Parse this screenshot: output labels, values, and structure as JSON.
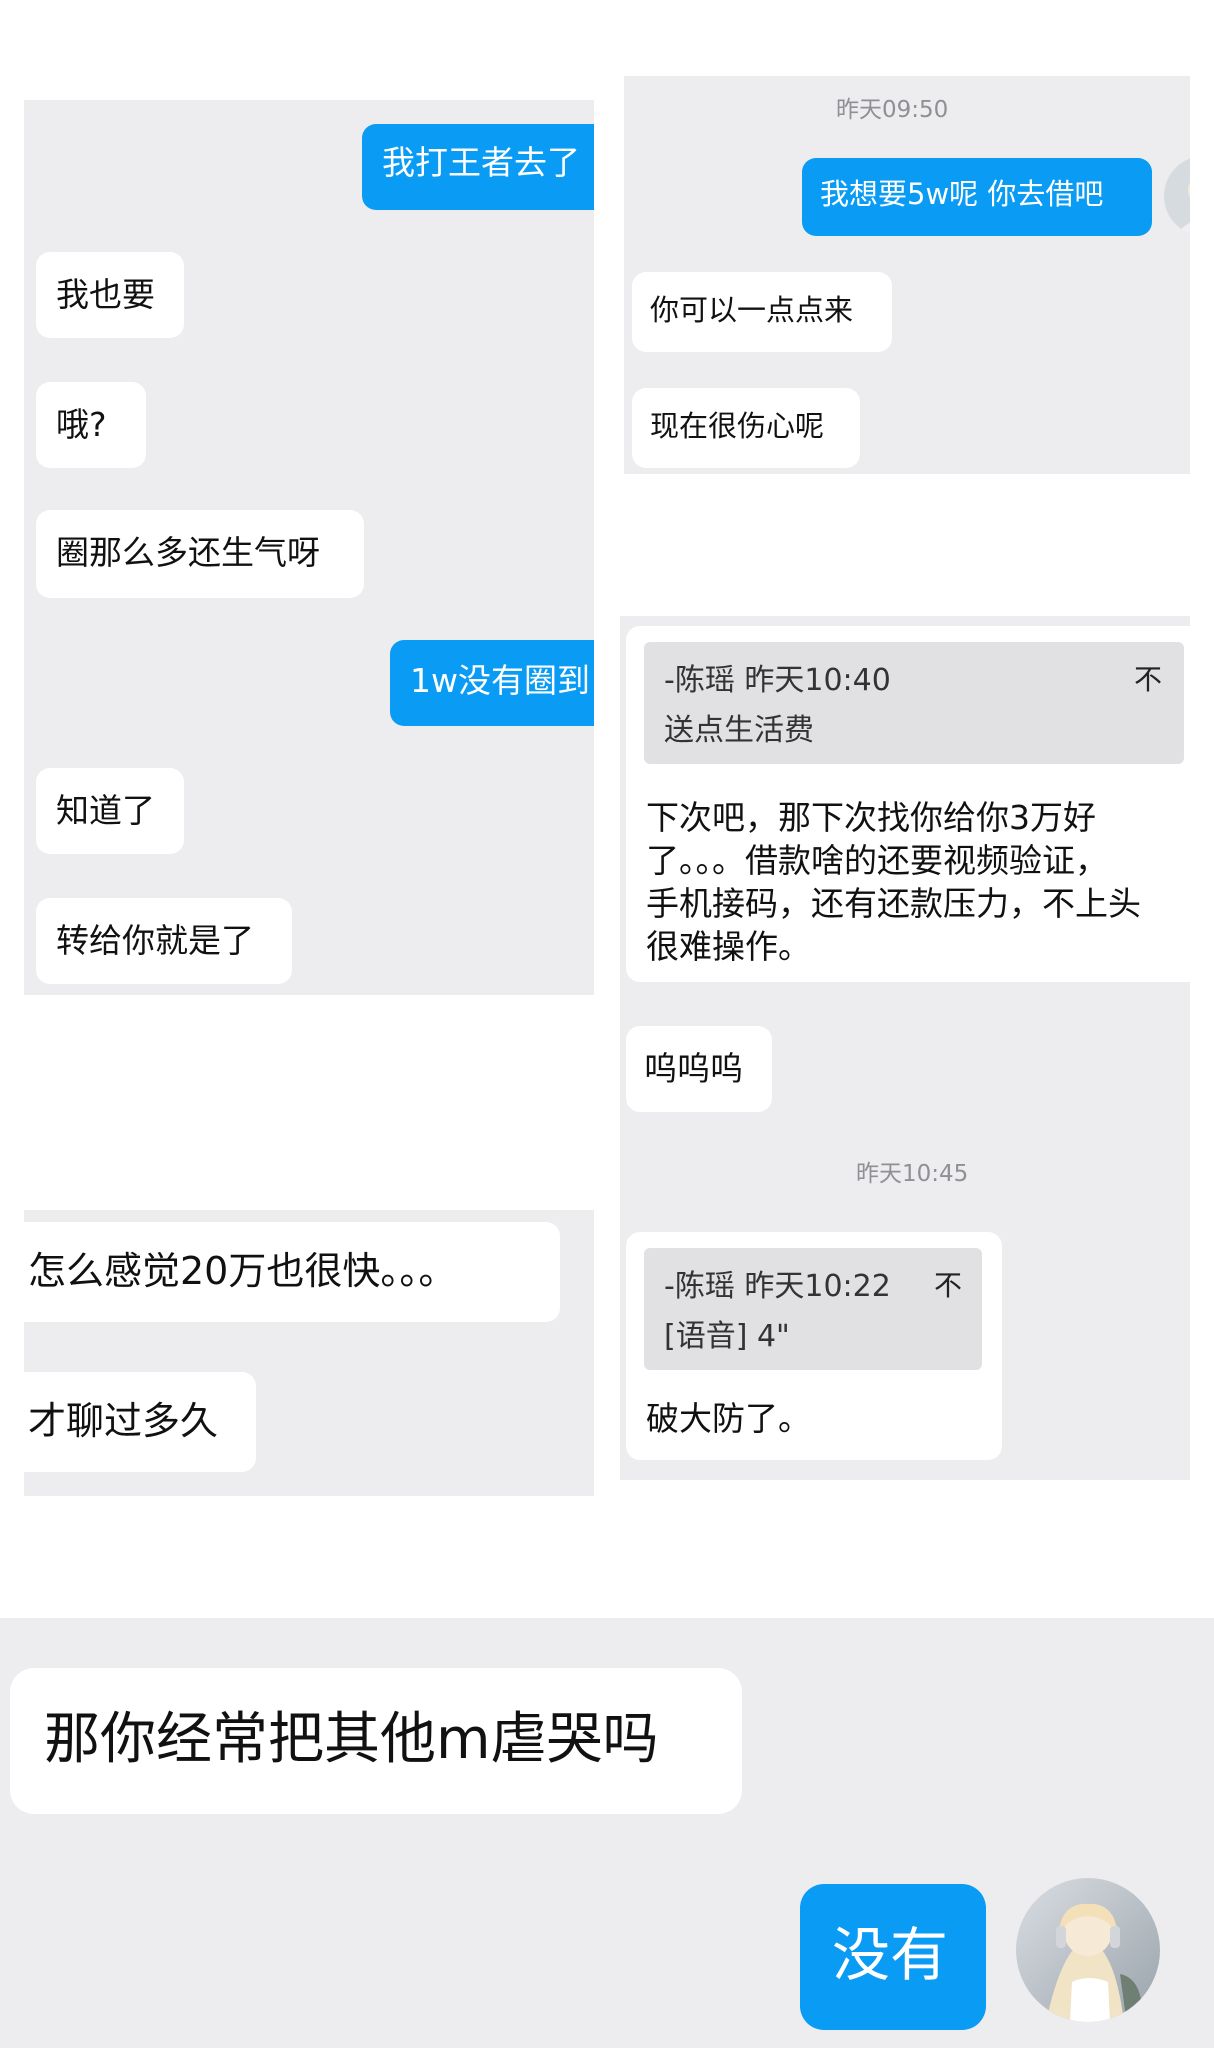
{
  "panel_a": {
    "messages": [
      {
        "text": "我打王者去了",
        "side": "out"
      },
      {
        "text": "我也要",
        "side": "in"
      },
      {
        "text": "哦?",
        "side": "in"
      },
      {
        "text": "圈那么多还生气呀",
        "side": "in"
      },
      {
        "text": "1w没有圈到",
        "side": "out"
      },
      {
        "text": "知道了",
        "side": "in"
      },
      {
        "text": "转给你就是了",
        "side": "in"
      }
    ]
  },
  "panel_b": {
    "timestamp": "昨天09:50",
    "messages": [
      {
        "text": "我想要5w呢 你去借吧",
        "side": "out"
      },
      {
        "text": "你可以一点点来",
        "side": "in"
      },
      {
        "text": "现在很伤心呢",
        "side": "in"
      }
    ]
  },
  "panel_c": {
    "quote": {
      "author_time": "-陈瑶 昨天10:40",
      "text": "送点生活费",
      "pin_glyph": "不"
    },
    "reply_lines": [
      "下次吧，那下次找你给你3万好",
      "了。。。借款啥的还要视频验证，",
      "手机接码，还有还款压力，不上头",
      "很难操作。"
    ],
    "message_wuwu": "呜呜呜",
    "timestamp": "昨天10:45",
    "quote2": {
      "author_time": "-陈瑶 昨天10:22",
      "text": "[语音] 4\"",
      "pin_glyph": "不"
    },
    "reply2": "破大防了。"
  },
  "panel_d": {
    "messages": [
      {
        "text": "怎么感觉20万也很快。。。",
        "side": "in"
      },
      {
        "text": "才聊过多久",
        "side": "in"
      }
    ]
  },
  "panel_e": {
    "message_in": "那你经常把其他m虐哭吗",
    "message_out": "没有"
  },
  "colors": {
    "outgoing_bubble": "#0a9cf5",
    "incoming_bubble": "#ffffff",
    "chat_background": "#ededf0",
    "quote_background": "#e1e1e3",
    "timestamp_text": "#8f8f95"
  },
  "icons": {
    "avatar": "user-avatar-photo",
    "pin": "pin-glyph"
  }
}
